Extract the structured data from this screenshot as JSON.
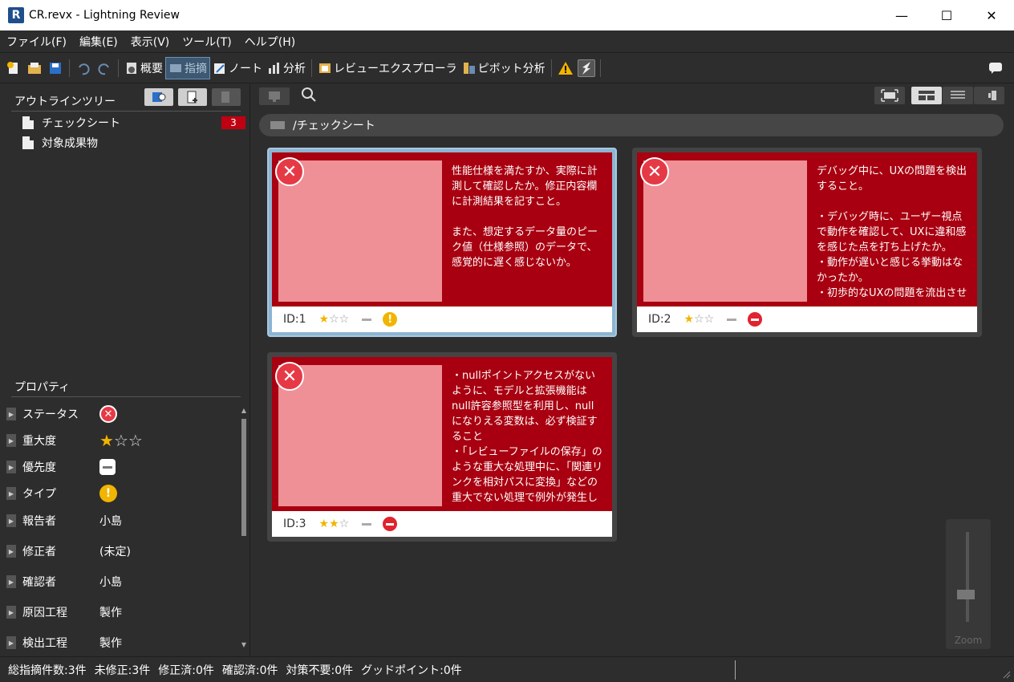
{
  "window": {
    "app_letter": "R",
    "title": "CR.revx  - Lightning Review",
    "minimize": "—",
    "maximize": "☐",
    "close": "✕"
  },
  "menu": [
    "ファイル(F)",
    "編集(E)",
    "表示(V)",
    "ツール(T)",
    "ヘルプ(H)"
  ],
  "toolbar": {
    "overview": "概要",
    "issues": "指摘",
    "note": "ノート",
    "analysis": "分析",
    "review_explorer": "レビューエクスプローラ",
    "pivot": "ピボット分析"
  },
  "outline": {
    "title": "アウトラインツリー",
    "items": [
      {
        "label": "チェックシート",
        "count": "3"
      },
      {
        "label": "対象成果物"
      }
    ]
  },
  "properties": {
    "title": "プロパティ",
    "rows": [
      {
        "label": "ステータス"
      },
      {
        "label": "重大度",
        "stars": 1
      },
      {
        "label": "優先度"
      },
      {
        "label": "タイプ"
      },
      {
        "label": "報告者",
        "value": "小島"
      },
      {
        "label": "修正者",
        "value": "(未定)"
      },
      {
        "label": "確認者",
        "value": "小島"
      },
      {
        "label": "原因工程",
        "value": "製作"
      },
      {
        "label": "検出工程",
        "value": "製作"
      }
    ]
  },
  "breadcrumb": "/チェックシート",
  "cards": [
    {
      "id": "ID:1",
      "stars": 1,
      "type": "warning",
      "desc": "性能仕様を満たすか、実際に計測して確認したか。修正内容欄に計測結果を記すこと。\n\nまた、想定するデータ量のピーク値（仕様参照）のデータで、感覚的に遅く感じないか。"
    },
    {
      "id": "ID:2",
      "stars": 1,
      "type": "stop",
      "desc": "デバッグ中に、UXの問題を検出すること。\n\n・デバッグ時に、ユーザー視点で動作を確認して、UXに違和感を感じた点を打ち上げたか。\n・動作が遅いと感じる挙動はなかったか。\n・初歩的なUXの問題を流出させていないか。"
    },
    {
      "id": "ID:3",
      "stars": 2,
      "type": "stop",
      "desc": "・nullポイントアクセスがないように、モデルと拡張機能はnull許容参照型を利用し、nullになりえる変数は、必ず検証すること\n・「レビューファイルの保存」のような重大な処理中に、「関連リンクを相対パスに変換」などの重大でない処理で例外が発生して、重大な処理が中断すないこと。"
    }
  ],
  "zoom_label": "Zoom",
  "status": {
    "total": "総指摘件数:3件",
    "unfixed": "未修正:3件",
    "fixed": "修正済:0件",
    "confirmed": "確認済:0件",
    "no_action": "対策不要:0件",
    "good": "グッドポイント:0件"
  },
  "colors": {
    "card_red": "#a80010",
    "thumb_pink": "#ee9096",
    "star": "#f1b400",
    "badge": "#c00012",
    "selected_border": "#a6c8e0"
  }
}
